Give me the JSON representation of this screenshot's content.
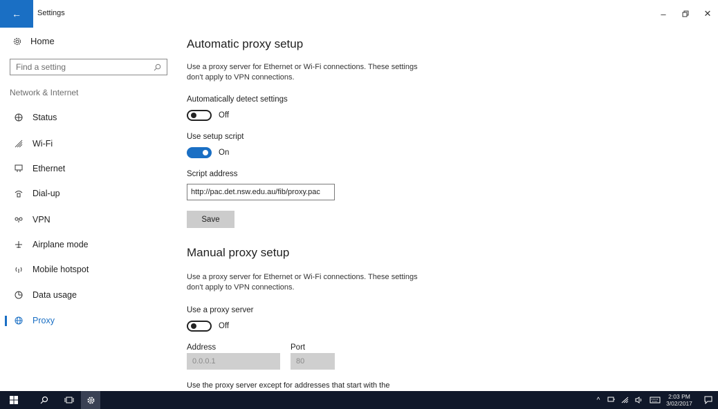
{
  "window": {
    "title": "Settings",
    "back_icon": "←",
    "minimize_icon": "–",
    "restore_icon": "🗗",
    "close_icon": "✕"
  },
  "sidebar": {
    "home_label": "Home",
    "search_placeholder": "Find a setting",
    "section_label": "Network & Internet",
    "items": [
      {
        "label": "Status",
        "icon": "globe-status-icon"
      },
      {
        "label": "Wi-Fi",
        "icon": "wifi-icon"
      },
      {
        "label": "Ethernet",
        "icon": "ethernet-icon"
      },
      {
        "label": "Dial-up",
        "icon": "dialup-icon"
      },
      {
        "label": "VPN",
        "icon": "vpn-icon"
      },
      {
        "label": "Airplane mode",
        "icon": "airplane-icon"
      },
      {
        "label": "Mobile hotspot",
        "icon": "hotspot-icon"
      },
      {
        "label": "Data usage",
        "icon": "data-usage-icon"
      },
      {
        "label": "Proxy",
        "icon": "globe-icon",
        "active": true
      }
    ]
  },
  "auto_proxy": {
    "heading": "Automatic proxy setup",
    "description": "Use a proxy server for Ethernet or Wi-Fi connections. These settings don't apply to VPN connections.",
    "detect_label": "Automatically detect settings",
    "detect_state": "Off",
    "script_label": "Use setup script",
    "script_state": "On",
    "address_label": "Script address",
    "address_value": "http://pac.det.nsw.edu.au/fib/proxy.pac",
    "save_label": "Save"
  },
  "manual_proxy": {
    "heading": "Manual proxy setup",
    "description": "Use a proxy server for Ethernet or Wi-Fi connections. These settings don't apply to VPN connections.",
    "use_proxy_label": "Use a proxy server",
    "use_proxy_state": "Off",
    "address_label": "Address",
    "address_value": "0.0.0.1",
    "port_label": "Port",
    "port_value": "80",
    "exceptions_text": "Use the proxy server except for addresses that start with the"
  },
  "taskbar": {
    "time": "2:03 PM",
    "date": "3/02/2017"
  },
  "colors": {
    "accent": "#1a6fc4",
    "taskbar": "#10182a"
  }
}
